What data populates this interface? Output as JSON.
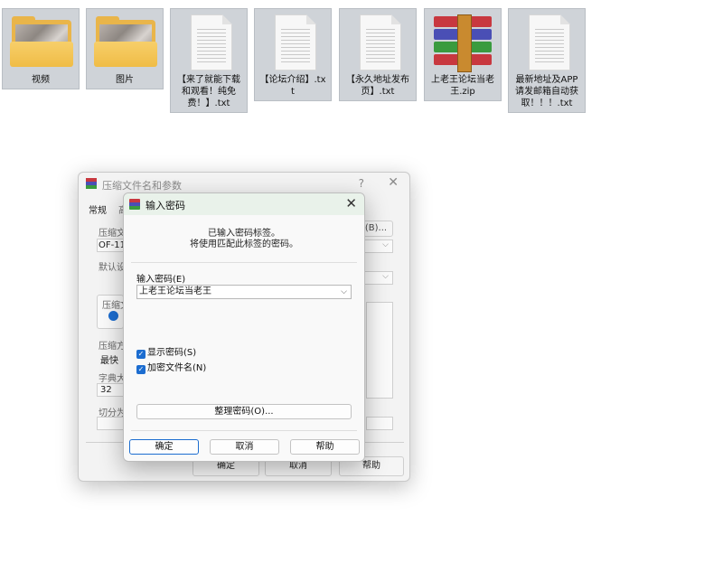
{
  "desktop": {
    "files": [
      {
        "type": "folder",
        "label": "视频"
      },
      {
        "type": "folder",
        "label": "图片"
      },
      {
        "type": "txt",
        "label": "【来了就能下载和观看！纯免费！】.txt"
      },
      {
        "type": "txt",
        "label": "【论坛介绍】.txt"
      },
      {
        "type": "txt",
        "label": "【永久地址发布页】.txt"
      },
      {
        "type": "zip",
        "label": "上老王论坛当老王.zip"
      },
      {
        "type": "txt",
        "label": "最新地址及APP请发邮箱自动获取！！！.txt"
      }
    ]
  },
  "back_dialog": {
    "title": "压缩文件名和参数",
    "help_glyph": "?",
    "tab_general": "常规",
    "tab_partial": "高",
    "archive_label": "压缩文",
    "archive_value": "OF-115",
    "browse_button": "(B)...",
    "default_label": "默认设",
    "format_label": "压缩文",
    "method_label": "压缩方",
    "method_value": "最快",
    "dict_label": "字典大",
    "dict_value": "32",
    "split_label": "切分为",
    "ok_button": "确定",
    "cancel_button": "取消",
    "help_button": "帮助"
  },
  "password_dialog": {
    "title": "输入密码",
    "info_line1": "已输入密码标签。",
    "info_line2": "将使用匹配此标签的密码。",
    "password_label": "输入密码(E)",
    "password_value": "上老王论坛当老王",
    "show_password_label": "显示密码(S)",
    "encrypt_names_label": "加密文件名(N)",
    "organize_button": "整理密码(O)...",
    "ok_button": "确定",
    "cancel_button": "取消",
    "help_button": "帮助"
  }
}
